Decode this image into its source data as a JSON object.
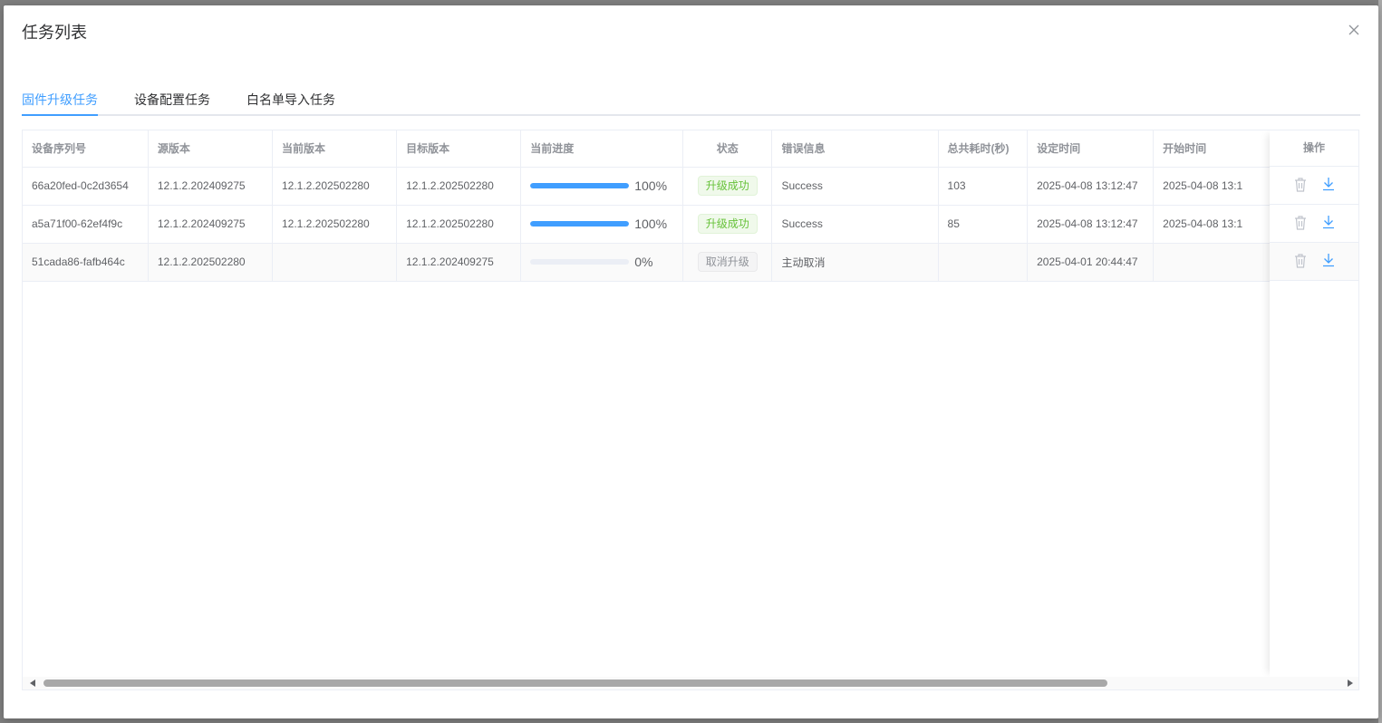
{
  "dialog": {
    "title": "任务列表"
  },
  "tabs": [
    {
      "label": "固件升级任务",
      "active": true
    },
    {
      "label": "设备配置任务",
      "active": false
    },
    {
      "label": "白名单导入任务",
      "active": false
    }
  ],
  "table": {
    "columns": [
      "设备序列号",
      "源版本",
      "当前版本",
      "目标版本",
      "当前进度",
      "状态",
      "错误信息",
      "总共耗时(秒)",
      "设定时间",
      "开始时间",
      "操作"
    ],
    "rows": [
      {
        "serial": "66a20fed-0c2d3654",
        "source": "12.1.2.202409275",
        "current": "12.1.2.202502280",
        "target": "12.1.2.202502280",
        "progress": 100,
        "progress_label": "100%",
        "status": "升级成功",
        "status_type": "success",
        "error": "Success",
        "duration": "103",
        "set_time": "2025-04-08 13:12:47",
        "start_time": "2025-04-08 13:1"
      },
      {
        "serial": "a5a71f00-62ef4f9c",
        "source": "12.1.2.202409275",
        "current": "12.1.2.202502280",
        "target": "12.1.2.202502280",
        "progress": 100,
        "progress_label": "100%",
        "status": "升级成功",
        "status_type": "success",
        "error": "Success",
        "duration": "85",
        "set_time": "2025-04-08 13:12:47",
        "start_time": "2025-04-08 13:1"
      },
      {
        "serial": "51cada86-fafb464c",
        "source": "12.1.2.202502280",
        "current": "",
        "target": "12.1.2.202409275",
        "progress": 0,
        "progress_label": "0%",
        "status": "取消升级",
        "status_type": "info",
        "error": "主动取消",
        "duration": "",
        "set_time": "2025-04-01 20:44:47",
        "start_time": ""
      }
    ]
  },
  "icons": {
    "close": "close-icon",
    "delete": "trash-icon",
    "download": "download-icon"
  },
  "colors": {
    "accent": "#409eff",
    "success": "#67c23a",
    "muted": "#909399",
    "text": "#606266"
  }
}
